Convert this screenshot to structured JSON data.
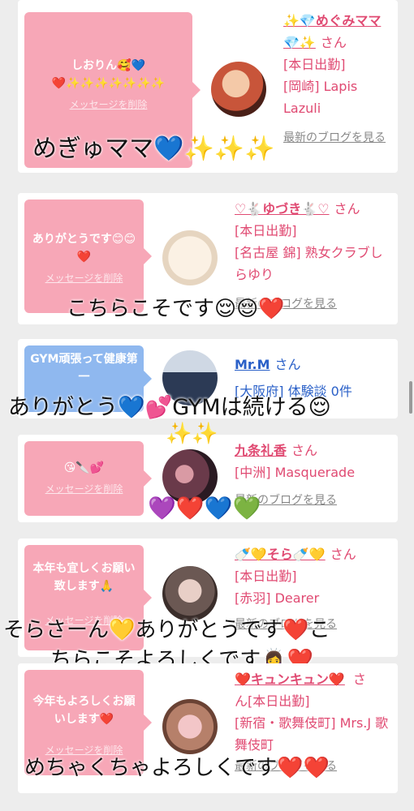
{
  "cards": [
    {
      "bubble_msg": "しおりん🥰💙\n❤️✨✨✨✨✨✨✨",
      "bubble_delete": "メッセージを削除",
      "name": "✨💎めぐみママ💎✨",
      "san": "さん",
      "status": "[本日出勤]",
      "shop": "[岡崎] Lapis Lazuli",
      "blog": "最新のブログを見る",
      "reply": "めぎゅママ💙✨✨✨"
    },
    {
      "bubble_msg": "ありがとうです😊😊❤️",
      "bubble_delete": "メッセージを削除",
      "name": "♡🐇ゆづき🐇♡",
      "san": "さん",
      "status": "[本日出勤]",
      "shop": "[名古屋 錦] 熟女クラブしらゆり",
      "blog": "最新のブログを見る",
      "reply": "こちらこそです😌😌❤️"
    },
    {
      "bubble_msg": "GYM頑張って健康第一",
      "bubble_delete": "メッセージを削除",
      "name": "Mr.M",
      "san": "さん",
      "shop": "[大阪府] 体験談 0件",
      "reply": "ありがとう💙💕GYMは続ける😌"
    },
    {
      "bubble_msg": "😘🔪💕",
      "bubble_delete": "メッセージを削除",
      "name": "九条礼香",
      "san": "さん",
      "shop": "[中洲] Masquerade",
      "blog": "最新のブログを見る",
      "reply": "💜❤️💙💚",
      "sparkle": "✨✨"
    },
    {
      "bubble_msg": "本年も宜しくお願い致します🙏",
      "bubble_delete": "メッセージを削除",
      "name": "🍼💛そら🍼💛",
      "san": "さん",
      "status": "[本日出勤]",
      "shop": "[赤羽] Dearer",
      "blog": "最新のブログを見る",
      "reply_line1": "そらさーん💛ありがとうです❤️こ",
      "reply_line2": "ちらこそよろしくです🙇‍♀️❤️"
    },
    {
      "bubble_msg": "今年もよろしくお願いします❤️",
      "bubble_delete": "メッセージを削除",
      "name": "❤️キュンキュン❤️",
      "san": "さ",
      "status": "ん[本日出勤]",
      "shop": "[新宿・歌舞伎町] Mrs.J 歌舞伎町",
      "blog": "最新のブログを見る",
      "reply": "めちゃくちゃよろしくです❤️❤️"
    }
  ],
  "colors": {
    "bubble_pink": "#f7a7b7",
    "bubble_blue": "#8fb8ef",
    "name_pink": "#e04a72",
    "name_blue": "#2a60c8",
    "background": "#ededed"
  }
}
